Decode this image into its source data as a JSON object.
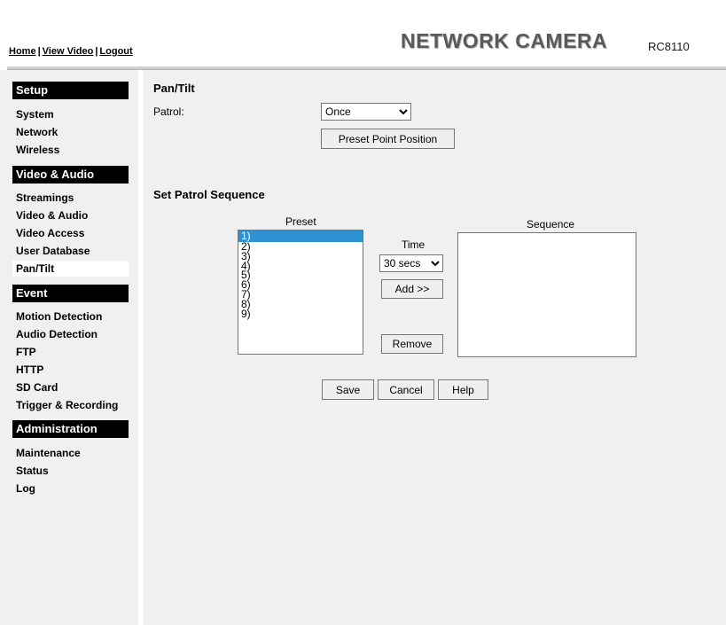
{
  "header": {
    "links": {
      "home": "Home",
      "view_video": "View Video",
      "logout": "Logout",
      "separator": "|"
    },
    "brand": "NETWORK CAMERA",
    "model": "RC8110"
  },
  "sidebar": {
    "setup": {
      "title": "Setup",
      "items": [
        "System",
        "Network",
        "Wireless"
      ]
    },
    "video_audio": {
      "title": "Video & Audio",
      "items": [
        "Streamings",
        "Video & Audio",
        "Video Access",
        "User Database",
        "Pan/Tilt"
      ]
    },
    "event": {
      "title": "Event",
      "items": [
        "Motion Detection",
        "Audio Detection",
        "FTP",
        "HTTP",
        "SD Card",
        "Trigger & Recording"
      ]
    },
    "administration": {
      "title": "Administration",
      "items": [
        "Maintenance",
        "Status",
        "Log"
      ]
    },
    "active_item": "Pan/Tilt"
  },
  "main": {
    "title": "Pan/Tilt",
    "patrol_label": "Patrol:",
    "patrol_value": "Once",
    "preset_position_button": "Preset Point Position",
    "sequence_title": "Set Patrol Sequence",
    "preset_label": "Preset",
    "preset_options": [
      "1)",
      "2)",
      "3)",
      "4)",
      "5)",
      "6)",
      "7)",
      "8)",
      "9)"
    ],
    "preset_selected_index": 0,
    "time_label": "Time",
    "time_value": "30 secs",
    "add_button": "Add >>",
    "remove_button": "Remove",
    "sequence_label": "Sequence",
    "sequence_items": [],
    "save_button": "Save",
    "cancel_button": "Cancel",
    "help_button": "Help"
  },
  "colors": {
    "panel_bg": "#f0f0f0",
    "brand_text": "#595959",
    "selection": "#2f90d2",
    "category_bg": "#000000"
  }
}
